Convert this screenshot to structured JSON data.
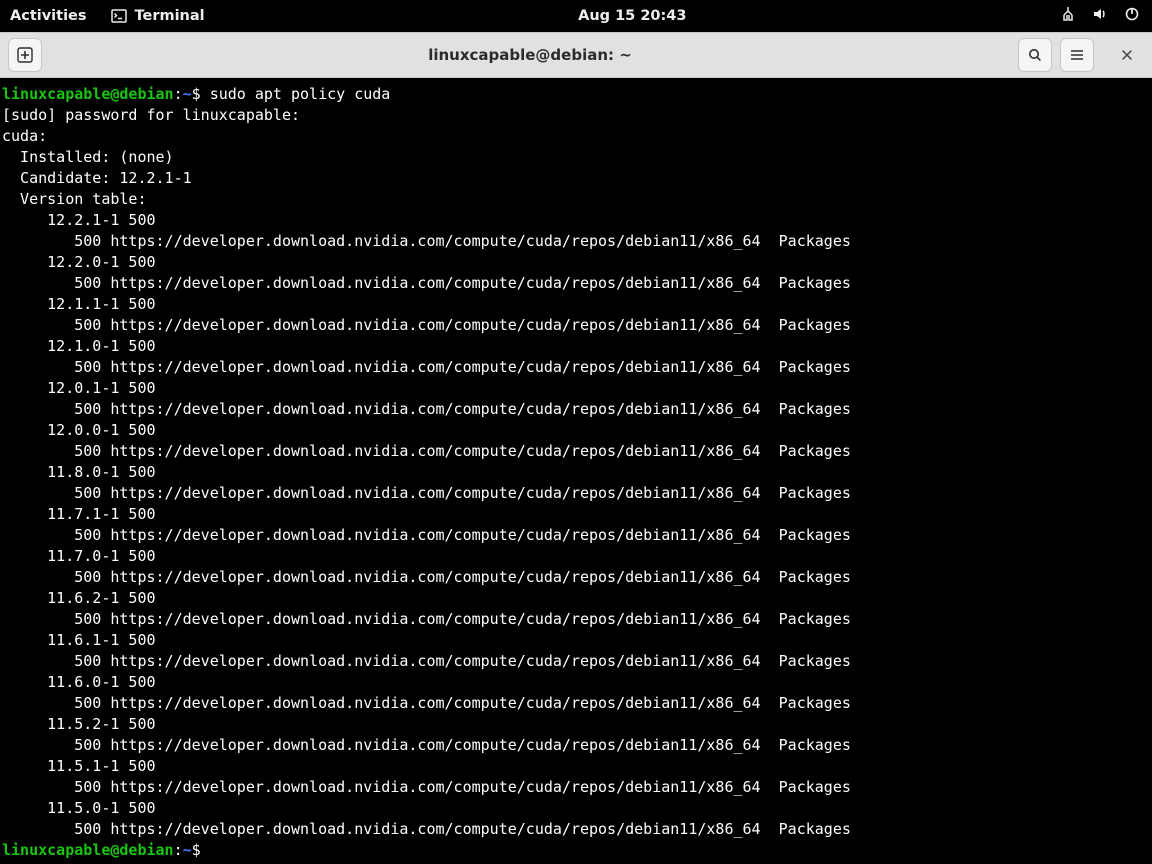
{
  "topbar": {
    "activities": "Activities",
    "app_name": "Terminal",
    "datetime": "Aug 15  20:43"
  },
  "window": {
    "title": "linuxcapable@debian: ~"
  },
  "prompt": {
    "user_host": "linuxcapable@debian",
    "colon": ":",
    "cwd": "~",
    "dollar": "$ ",
    "dollar_bare": "$"
  },
  "cmd": {
    "entered": "sudo apt policy cuda"
  },
  "out": {
    "pwdline": "[sudo] password for linuxcapable:",
    "pkg": "cuda:",
    "installed": "  Installed: (none)",
    "candidate": "  Candidate: 12.2.1-1",
    "vtable": "  Version table:",
    "repo": "        500 https://developer.download.nvidia.com/compute/cuda/repos/debian11/x86_64  Packages",
    "versions": [
      "     12.2.1-1 500",
      "     12.2.0-1 500",
      "     12.1.1-1 500",
      "     12.1.0-1 500",
      "     12.0.1-1 500",
      "     12.0.0-1 500",
      "     11.8.0-1 500",
      "     11.7.1-1 500",
      "     11.7.0-1 500",
      "     11.6.2-1 500",
      "     11.6.1-1 500",
      "     11.6.0-1 500",
      "     11.5.2-1 500",
      "     11.5.1-1 500",
      "     11.5.0-1 500"
    ]
  }
}
